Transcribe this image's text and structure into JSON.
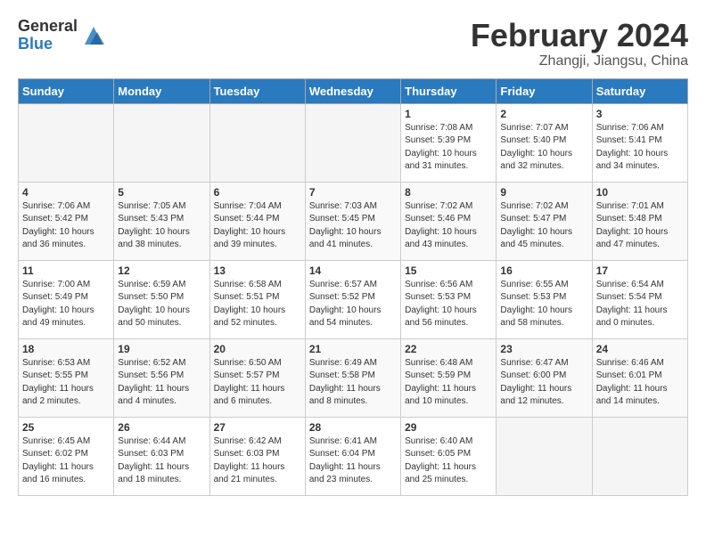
{
  "header": {
    "logo_general": "General",
    "logo_blue": "Blue",
    "title": "February 2024",
    "subtitle": "Zhangji, Jiangsu, China"
  },
  "weekdays": [
    "Sunday",
    "Monday",
    "Tuesday",
    "Wednesday",
    "Thursday",
    "Friday",
    "Saturday"
  ],
  "weeks": [
    [
      {
        "day": "",
        "empty": true
      },
      {
        "day": "",
        "empty": true
      },
      {
        "day": "",
        "empty": true
      },
      {
        "day": "",
        "empty": true
      },
      {
        "day": "1",
        "sunrise": "7:08 AM",
        "sunset": "5:39 PM",
        "daylight": "10 hours and 31 minutes."
      },
      {
        "day": "2",
        "sunrise": "7:07 AM",
        "sunset": "5:40 PM",
        "daylight": "10 hours and 32 minutes."
      },
      {
        "day": "3",
        "sunrise": "7:06 AM",
        "sunset": "5:41 PM",
        "daylight": "10 hours and 34 minutes."
      }
    ],
    [
      {
        "day": "4",
        "sunrise": "7:06 AM",
        "sunset": "5:42 PM",
        "daylight": "10 hours and 36 minutes."
      },
      {
        "day": "5",
        "sunrise": "7:05 AM",
        "sunset": "5:43 PM",
        "daylight": "10 hours and 38 minutes."
      },
      {
        "day": "6",
        "sunrise": "7:04 AM",
        "sunset": "5:44 PM",
        "daylight": "10 hours and 39 minutes."
      },
      {
        "day": "7",
        "sunrise": "7:03 AM",
        "sunset": "5:45 PM",
        "daylight": "10 hours and 41 minutes."
      },
      {
        "day": "8",
        "sunrise": "7:02 AM",
        "sunset": "5:46 PM",
        "daylight": "10 hours and 43 minutes."
      },
      {
        "day": "9",
        "sunrise": "7:02 AM",
        "sunset": "5:47 PM",
        "daylight": "10 hours and 45 minutes."
      },
      {
        "day": "10",
        "sunrise": "7:01 AM",
        "sunset": "5:48 PM",
        "daylight": "10 hours and 47 minutes."
      }
    ],
    [
      {
        "day": "11",
        "sunrise": "7:00 AM",
        "sunset": "5:49 PM",
        "daylight": "10 hours and 49 minutes."
      },
      {
        "day": "12",
        "sunrise": "6:59 AM",
        "sunset": "5:50 PM",
        "daylight": "10 hours and 50 minutes."
      },
      {
        "day": "13",
        "sunrise": "6:58 AM",
        "sunset": "5:51 PM",
        "daylight": "10 hours and 52 minutes."
      },
      {
        "day": "14",
        "sunrise": "6:57 AM",
        "sunset": "5:52 PM",
        "daylight": "10 hours and 54 minutes."
      },
      {
        "day": "15",
        "sunrise": "6:56 AM",
        "sunset": "5:53 PM",
        "daylight": "10 hours and 56 minutes."
      },
      {
        "day": "16",
        "sunrise": "6:55 AM",
        "sunset": "5:53 PM",
        "daylight": "10 hours and 58 minutes."
      },
      {
        "day": "17",
        "sunrise": "6:54 AM",
        "sunset": "5:54 PM",
        "daylight": "11 hours and 0 minutes."
      }
    ],
    [
      {
        "day": "18",
        "sunrise": "6:53 AM",
        "sunset": "5:55 PM",
        "daylight": "11 hours and 2 minutes."
      },
      {
        "day": "19",
        "sunrise": "6:52 AM",
        "sunset": "5:56 PM",
        "daylight": "11 hours and 4 minutes."
      },
      {
        "day": "20",
        "sunrise": "6:50 AM",
        "sunset": "5:57 PM",
        "daylight": "11 hours and 6 minutes."
      },
      {
        "day": "21",
        "sunrise": "6:49 AM",
        "sunset": "5:58 PM",
        "daylight": "11 hours and 8 minutes."
      },
      {
        "day": "22",
        "sunrise": "6:48 AM",
        "sunset": "5:59 PM",
        "daylight": "11 hours and 10 minutes."
      },
      {
        "day": "23",
        "sunrise": "6:47 AM",
        "sunset": "6:00 PM",
        "daylight": "11 hours and 12 minutes."
      },
      {
        "day": "24",
        "sunrise": "6:46 AM",
        "sunset": "6:01 PM",
        "daylight": "11 hours and 14 minutes."
      }
    ],
    [
      {
        "day": "25",
        "sunrise": "6:45 AM",
        "sunset": "6:02 PM",
        "daylight": "11 hours and 16 minutes."
      },
      {
        "day": "26",
        "sunrise": "6:44 AM",
        "sunset": "6:03 PM",
        "daylight": "11 hours and 18 minutes."
      },
      {
        "day": "27",
        "sunrise": "6:42 AM",
        "sunset": "6:03 PM",
        "daylight": "11 hours and 21 minutes."
      },
      {
        "day": "28",
        "sunrise": "6:41 AM",
        "sunset": "6:04 PM",
        "daylight": "11 hours and 23 minutes."
      },
      {
        "day": "29",
        "sunrise": "6:40 AM",
        "sunset": "6:05 PM",
        "daylight": "11 hours and 25 minutes."
      },
      {
        "day": "",
        "empty": true
      },
      {
        "day": "",
        "empty": true
      }
    ]
  ]
}
